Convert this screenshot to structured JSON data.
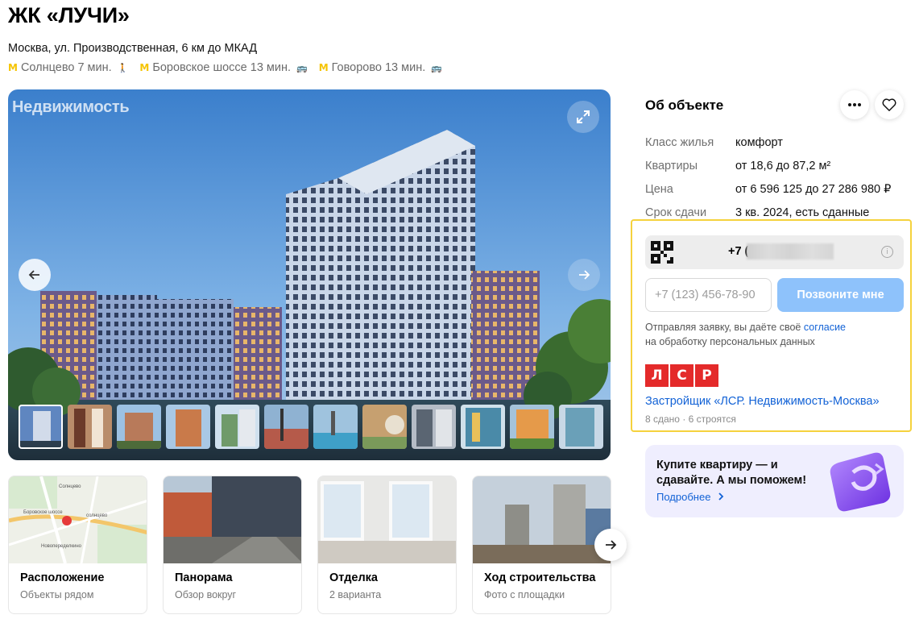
{
  "title": "ЖК «ЛУЧИ»",
  "address": "Москва, ул. Производственная, 6 км до МКАД",
  "metro": [
    {
      "name": "Солнцево",
      "time": "7 мин.",
      "mode_icon": "walk-icon",
      "mode_glyph": "🚶"
    },
    {
      "name": "Боровское шоссе",
      "time": "13 мин.",
      "mode_icon": "bus-icon",
      "mode_glyph": "🚌"
    },
    {
      "name": "Говорово",
      "time": "13 мин.",
      "mode_icon": "bus-icon",
      "mode_glyph": "🚌"
    }
  ],
  "metro_symbol": "M",
  "gallery": {
    "watermark": "Недвижимость",
    "thumbnail_count": 12
  },
  "cards": [
    {
      "title": "Расположение",
      "subtitle": "Объекты рядом"
    },
    {
      "title": "Панорама",
      "subtitle": "Обзор вокруг"
    },
    {
      "title": "Отделка",
      "subtitle": "2 варианта"
    },
    {
      "title": "Ход строительства",
      "subtitle": "Фото с площадки"
    }
  ],
  "map_labels": {
    "l1": "Солнцево",
    "l2": "Боровское шоссе",
    "l3": "солнцево",
    "l4": "Новопеределкино"
  },
  "about": {
    "title": "Об объекте",
    "specs": [
      {
        "key": "Класс жилья",
        "value": "комфорт"
      },
      {
        "key": "Квартиры",
        "value": "от 18,6 до 87,2 м²"
      },
      {
        "key": "Цена",
        "value": "от 6 596 125 до 27 286 980 ₽"
      },
      {
        "key": "Срок сдачи",
        "value": "3 кв. 2024, есть сданные"
      }
    ]
  },
  "contact": {
    "phone_visible": "+7 (9",
    "info_glyph": "i",
    "input_placeholder": "+7 (123) 456-78-90",
    "call_button": "Позвоните мне",
    "consent_text": "Отправляя заявку, вы даёте своё",
    "consent_link": "согласие",
    "consent_text_2": "на обработку персональных данных",
    "developer_logo": [
      "Л",
      "С",
      "Р"
    ],
    "developer_name": "Застройщик «ЛСР. Недвижимость-Москва»",
    "developer_stats": "8 сдано · 6 строятся"
  },
  "promo": {
    "text": "Купите квартиру — и сдавайте. А мы поможем!",
    "link": "Подробнее"
  },
  "colors": {
    "accent_blue": "#1262d6",
    "call_button": "#8ec2fb",
    "highlight_border": "#f5d23d",
    "brand_red": "#e42a2a",
    "metro_yellow": "#f5c400"
  }
}
